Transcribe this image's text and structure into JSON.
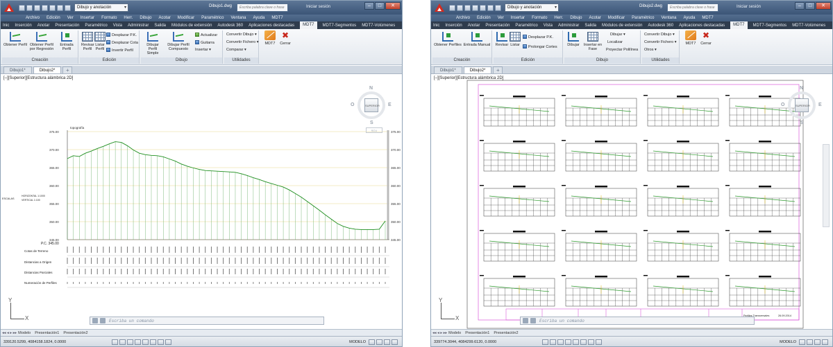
{
  "windows": [
    {
      "id": "left",
      "workspace": "Dibujo y anotación",
      "title": "Dibujo1.dwg",
      "search_placeholder": "Escriba palabra clave o frase",
      "signin": "Iniciar sesión",
      "menu": [
        "Archivo",
        "Edición",
        "Ver",
        "Insertar",
        "Formato",
        "Herr.",
        "Dibujo",
        "Acotar",
        "Modificar",
        "Paramétrico",
        "Ventana",
        "Ayuda",
        "MDT7"
      ],
      "tabs": [
        "Inic",
        "Inserción",
        "Anotar",
        "Presentación",
        "Paramétrico",
        "Vista",
        "Administrar",
        "Salida",
        "Módulos de extensión",
        "Autodesk 360",
        "Aplicaciones destacadas",
        "MDT7",
        "MDT7-Segmentos",
        "MDT7-Volúmenes"
      ],
      "active_tab": "MDT7",
      "ribbon": {
        "creacion": {
          "title": "Creación",
          "buttons": [
            "Obtener Perfil",
            "Obtener Perfil por Regresión",
            "Entrada Perfil"
          ]
        },
        "edicion": {
          "title": "Edición",
          "buttons": [
            "Revisar Perfil",
            "Listar Perfil"
          ],
          "small": [
            "Desplazar P.K.",
            "Desplazar Cota",
            "Invertir Perfil"
          ]
        },
        "dibujo": {
          "title": "Dibujo",
          "buttons": [
            "Dibujar Perfil Simple",
            "Dibujar Perfil Compuesto"
          ],
          "small": [
            "Actualizar",
            "Guitarra",
            "Insertar"
          ]
        },
        "utilidades": {
          "title": "Utilidades",
          "small": [
            "Convertir Dibujo",
            "Convertir Fichero",
            "Comparar"
          ]
        },
        "extra": [
          "MDT7",
          "Cerrar"
        ]
      },
      "file_tabs": [
        "Dibujo1*",
        "Dibujo2*"
      ],
      "viewport_label": "[–][Superior][Estructura alámbrica 2D]",
      "viewcube": {
        "face": "SUPERIOR",
        "n": "N",
        "s": "S",
        "e": "E",
        "o": "O",
        "wcs": "SCU"
      },
      "command_prompt": "Escriba un comando",
      "layout_tabs": [
        "Modelo",
        "Presentación1",
        "Presentación2"
      ],
      "coords": "339120.5299, 4084158.1824, 0.0000",
      "status_right": "MODELO"
    },
    {
      "id": "right",
      "workspace": "Dibujo y anotación",
      "title": "Dibujo2.dwg",
      "search_placeholder": "Escriba palabra clave o frase",
      "signin": "Iniciar sesión",
      "menu": [
        "Archivo",
        "Edición",
        "Ver",
        "Insertar",
        "Formato",
        "Herr.",
        "Dibujo",
        "Acotar",
        "Modificar",
        "Paramétrico",
        "Ventana",
        "Ayuda",
        "MDT7"
      ],
      "tabs": [
        "Inic",
        "Inserción",
        "Anotar",
        "Presentación",
        "Paramétrico",
        "Vista",
        "Administrar",
        "Salida",
        "Módulos de extensión",
        "Autodesk 360",
        "Aplicaciones destacadas",
        "MDT7",
        "MDT7-Segmentos",
        "MDT7-Volúmenes"
      ],
      "active_tab": "MDT7",
      "ribbon": {
        "creacion": {
          "title": "Creación",
          "buttons": [
            "Obtener Perfiles",
            "Entrada Manual"
          ]
        },
        "edicion": {
          "title": "Edición",
          "buttons": [
            "Revisar",
            "Listar"
          ],
          "small": [
            "Desplazar P.K.",
            "Prolongar Cortes"
          ]
        },
        "dibujo": {
          "title": "Dibujo",
          "buttons": [
            "Dibujar",
            "Insertar en Fase"
          ],
          "small": [
            "Dibujar",
            "Localizar",
            "Proyectar Polilínea"
          ]
        },
        "utilidades": {
          "title": "Utilidades",
          "small": [
            "Convertir Dibujo",
            "Convertir Fichero",
            "Otros"
          ]
        },
        "extra": [
          "MDT7",
          "Cerrar"
        ]
      },
      "file_tabs": [
        "Dibujo1*",
        "Dibujo2*"
      ],
      "viewport_label": "[–][Superior][Estructura alámbrica 2D]",
      "viewcube": {
        "face": "SUPERIOR",
        "n": "N",
        "s": "S",
        "e": "E",
        "o": "O",
        "wcs": "SCU"
      },
      "command_prompt": "Escriba un comando",
      "layout_tabs": [
        "Modelo",
        "Presentación1",
        "Presentación2"
      ],
      "coords": "339774.3044, 4084299.6120, 0.0000",
      "status_right": "MODELO"
    }
  ],
  "profile": {
    "title": "topografía",
    "ref_plane": "P.C. 345.00",
    "scale_label": "ESCALAS",
    "scale_h": "HORIZONTAL 1:1000",
    "scale_v": "VERTICAL 1:100",
    "row_labels": [
      "Cotas de Terreno",
      "Distancias a Origen",
      "Distancias Parciales",
      "Numeración de Perfiles"
    ],
    "elevation_ticks": [
      375,
      370,
      365,
      360,
      355,
      350,
      345
    ],
    "terrain": [
      367.5,
      368.3,
      368.1,
      369.0,
      369.6,
      370.3,
      370.9,
      371.6,
      372.2,
      372.0,
      371.1,
      369.9,
      369.0,
      368.6,
      368.4,
      368.3,
      368.0,
      367.4,
      366.8,
      366.0,
      365.4,
      364.9,
      364.5,
      364.2,
      364.1,
      364.0,
      363.9,
      363.8,
      363.7,
      363.3,
      362.8,
      362.2,
      361.7,
      361.1,
      360.6,
      360.1,
      359.6,
      358.8,
      357.8,
      356.8,
      355.6,
      354.4,
      353.2,
      351.9,
      350.7,
      349.5,
      348.7,
      348.2,
      347.9,
      347.8,
      347.8,
      347.8,
      347.9,
      350.2
    ]
  },
  "sheet": {
    "rows": 5,
    "cols": 4,
    "titleblock": [
      "",
      "",
      "",
      "",
      "",
      "Perfiles Transversales",
      "26.09.2014"
    ]
  }
}
